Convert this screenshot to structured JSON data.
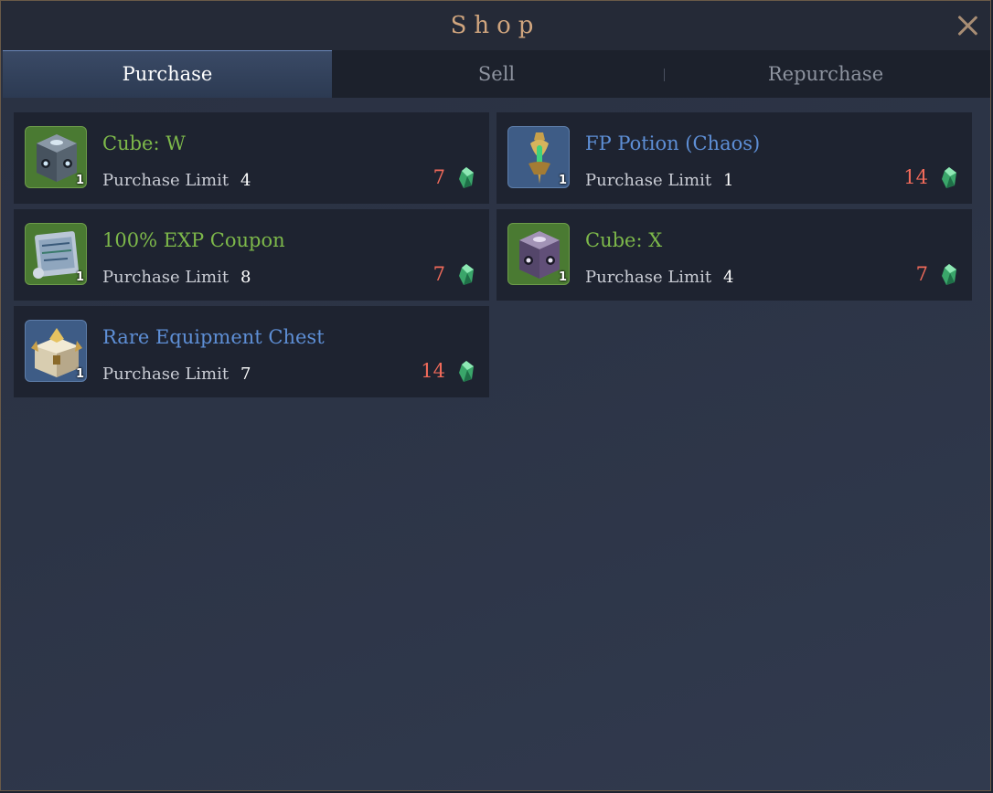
{
  "window": {
    "title": "Shop",
    "close_icon": "close-icon"
  },
  "tabs": [
    {
      "label": "Purchase",
      "active": true
    },
    {
      "label": "Sell",
      "active": false
    },
    {
      "label": "Repurchase",
      "active": false
    }
  ],
  "items": [
    {
      "name": "Cube: W",
      "name_color": "green",
      "icon": "cube-w-icon",
      "qty": "1",
      "limit_label": "Purchase Limit",
      "limit": "4",
      "price": "7",
      "currency_icon": "crystal-icon"
    },
    {
      "name": "FP Potion (Chaos)",
      "name_color": "blue",
      "icon": "fp-potion-icon",
      "qty": "1",
      "limit_label": "Purchase Limit",
      "limit": "1",
      "price": "14",
      "currency_icon": "crystal-icon"
    },
    {
      "name": "100% EXP Coupon",
      "name_color": "green",
      "icon": "exp-coupon-icon",
      "qty": "1",
      "limit_label": "Purchase Limit",
      "limit": "8",
      "price": "7",
      "currency_icon": "crystal-icon"
    },
    {
      "name": "Cube: X",
      "name_color": "green",
      "icon": "cube-x-icon",
      "qty": "1",
      "limit_label": "Purchase Limit",
      "limit": "4",
      "price": "7",
      "currency_icon": "crystal-icon"
    },
    {
      "name": "Rare Equipment Chest",
      "name_color": "blue",
      "icon": "equipment-chest-icon",
      "qty": "1",
      "limit_label": "Purchase Limit",
      "limit": "7",
      "price": "14",
      "currency_icon": "crystal-icon"
    }
  ],
  "colors": {
    "name_green": "#7db84a",
    "name_blue": "#5e8fd6",
    "price": "#f06a5a",
    "title": "#d0a57e"
  }
}
